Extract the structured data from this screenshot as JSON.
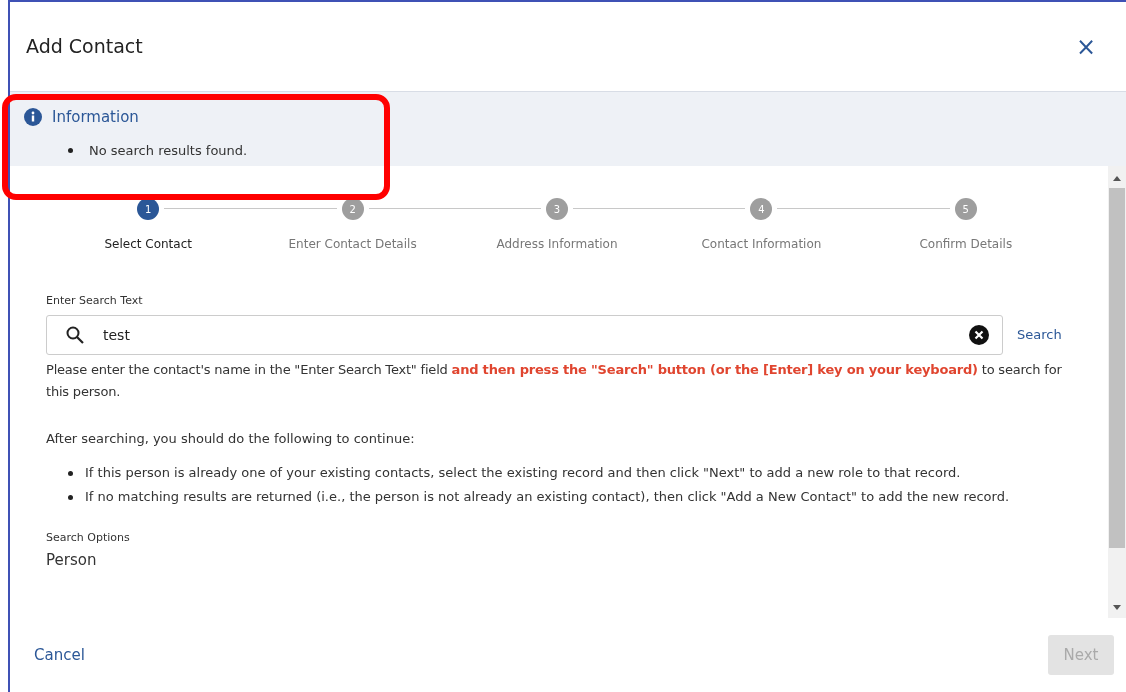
{
  "dialog": {
    "title": "Add Contact",
    "close_icon": "×"
  },
  "info_panel": {
    "highlighted": true,
    "title": "Information",
    "messages": [
      "No search results found."
    ]
  },
  "steps": [
    {
      "number": "1",
      "label": "Select Contact",
      "selected": true
    },
    {
      "number": "2",
      "label": "Enter Contact Details",
      "selected": false
    },
    {
      "number": "3",
      "label": "Address Information",
      "selected": false
    },
    {
      "number": "4",
      "label": "Contact Information",
      "selected": false
    },
    {
      "number": "5",
      "label": "Confirm Details",
      "selected": false
    }
  ],
  "search": {
    "label": "Enter Search Text",
    "value": "test",
    "button": "Search"
  },
  "instructions": "Please enter the contact's name in the \"Enter Search Text\" field **and then press the \"Search\" button (or the [Enter] key on your keyboard)** to search for this person.",
  "after_text": "After searching, you should do the following to continue:",
  "bullets": [
    "If this person is already one of your existing contacts, select the existing record and then click \"Next\" to add a new role to that record.",
    "If no matching results are returned (i.e., the person is not already an existing contact), then click \"Add a New Contact\" to add the new record."
  ],
  "search_options": {
    "label": "Search Options",
    "value": "Person"
  },
  "footer": {
    "cancel": "Cancel",
    "next": {
      "label": "Next",
      "disabled": true
    }
  }
}
